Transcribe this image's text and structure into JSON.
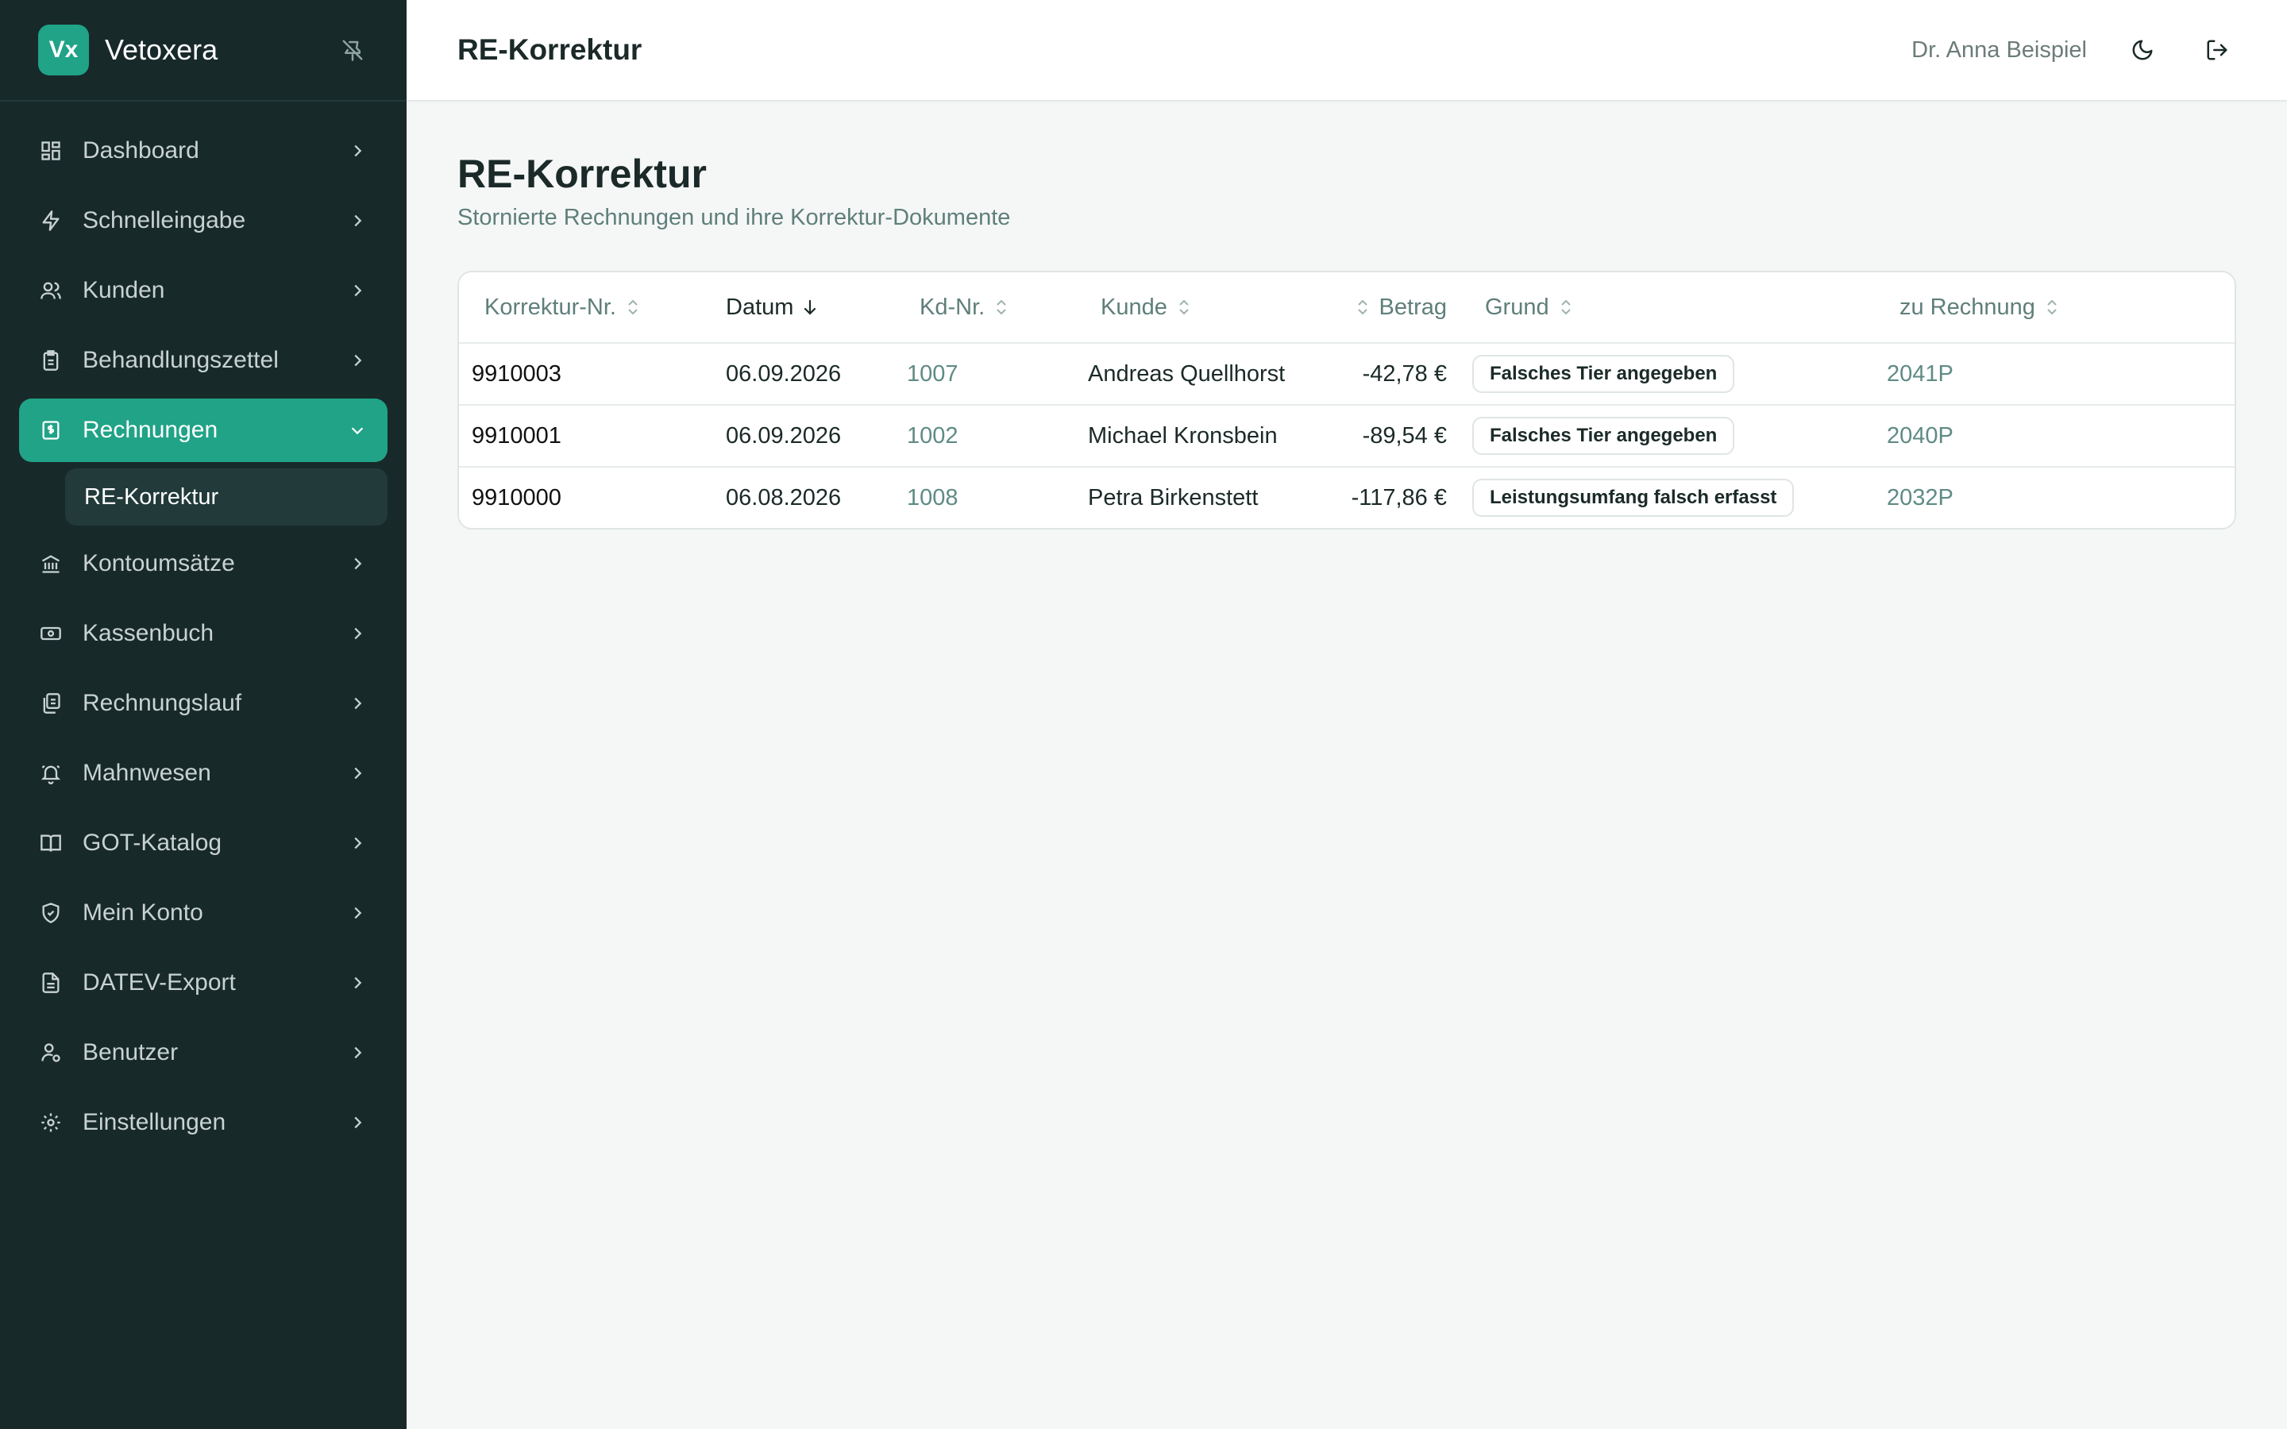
{
  "app": {
    "logo_text": "Vx",
    "name": "Vetoxera"
  },
  "sidebar": {
    "items": [
      {
        "label": "Dashboard",
        "icon": "dashboard-icon"
      },
      {
        "label": "Schnelleingabe",
        "icon": "lightning-icon"
      },
      {
        "label": "Kunden",
        "icon": "users-icon"
      },
      {
        "label": "Behandlungszettel",
        "icon": "clipboard-icon"
      },
      {
        "label": "Rechnungen",
        "icon": "invoice-icon",
        "active": true
      },
      {
        "label": "Kontoumsätze",
        "icon": "bank-icon"
      },
      {
        "label": "Kassenbuch",
        "icon": "cash-icon"
      },
      {
        "label": "Rechnungslauf",
        "icon": "documents-icon"
      },
      {
        "label": "Mahnwesen",
        "icon": "bell-icon"
      },
      {
        "label": "GOT-Katalog",
        "icon": "book-icon"
      },
      {
        "label": "Mein Konto",
        "icon": "shield-icon"
      },
      {
        "label": "DATEV-Export",
        "icon": "file-icon"
      },
      {
        "label": "Benutzer",
        "icon": "user-gear-icon"
      },
      {
        "label": "Einstellungen",
        "icon": "gear-icon"
      }
    ],
    "sub_item": "RE-Korrektur"
  },
  "topbar": {
    "title": "RE-Korrektur",
    "user": "Dr. Anna Beispiel"
  },
  "page": {
    "title": "RE-Korrektur",
    "subtitle": "Stornierte Rechnungen und ihre Korrektur-Dokumente"
  },
  "table": {
    "headers": [
      "Korrektur-Nr.",
      "Datum",
      "Kd-Nr.",
      "Kunde",
      "Betrag",
      "Grund",
      "zu Rechnung"
    ],
    "rows": [
      {
        "nr": "9910003",
        "datum": "06.09.2026",
        "kdnr": "1007",
        "kunde": "Andreas Quellhorst",
        "betrag": "-42,78 €",
        "grund": "Falsches Tier angegeben",
        "rechnung": "2041P"
      },
      {
        "nr": "9910001",
        "datum": "06.09.2026",
        "kdnr": "1002",
        "kunde": "Michael Kronsbein",
        "betrag": "-89,54 €",
        "grund": "Falsches Tier angegeben",
        "rechnung": "2040P"
      },
      {
        "nr": "9910000",
        "datum": "06.08.2026",
        "kdnr": "1008",
        "kunde": "Petra Birkenstett",
        "betrag": "-117,86 €",
        "grund": "Leistungsumfang falsch erfasst",
        "rechnung": "2032P"
      }
    ]
  },
  "colors": {
    "sidebar_bg": "#18292a",
    "accent": "#20a387",
    "muted_text": "#5f7f7a"
  }
}
